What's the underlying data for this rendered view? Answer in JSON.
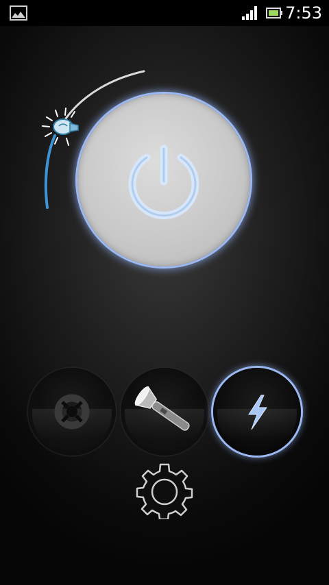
{
  "status_bar": {
    "time": "7:53",
    "icons": [
      "gallery-notification-icon",
      "signal-strength-icon",
      "battery-icon"
    ]
  },
  "power_button": {
    "icon": "power-icon",
    "state": "off"
  },
  "brightness_dial": {
    "icon": "light-bulb-icon"
  },
  "modes": [
    {
      "name": "screen-light",
      "icon": "lifebuoy-icon",
      "selected": false
    },
    {
      "name": "flashlight",
      "icon": "flashlight-icon",
      "selected": false
    },
    {
      "name": "strobe",
      "icon": "lightning-bolt-icon",
      "selected": true
    }
  ],
  "settings": {
    "icon": "gear-icon"
  },
  "colors": {
    "accent_blue": "#9cb8f2",
    "background": "#1f1e1e",
    "statusbar": "#000000"
  }
}
